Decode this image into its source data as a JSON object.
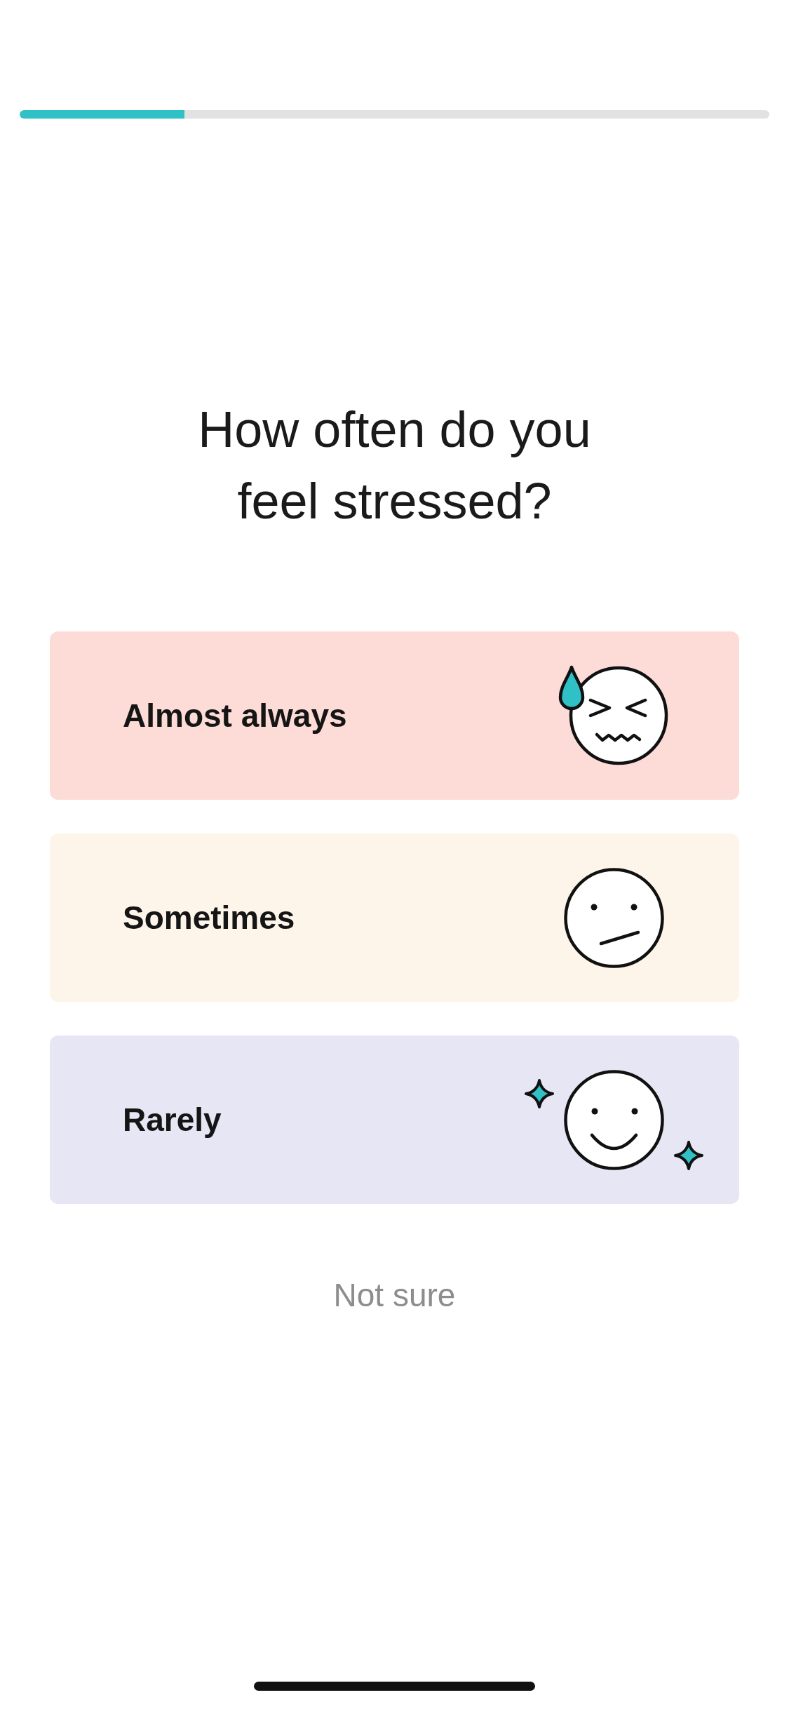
{
  "progress": {
    "level": 0.22
  },
  "question": "How often do you feel stressed?",
  "options": [
    {
      "label": "Almost always",
      "kind": "sweating",
      "color": "#fddcd8",
      "selected": false
    },
    {
      "label": "Sometimes",
      "kind": "uneasy",
      "color": "#fdf5e9",
      "selected": false
    },
    {
      "label": "Rarely",
      "kind": "smiling",
      "color": "#e7e6f4",
      "selected": false
    }
  ],
  "skip_link": "Not sure"
}
